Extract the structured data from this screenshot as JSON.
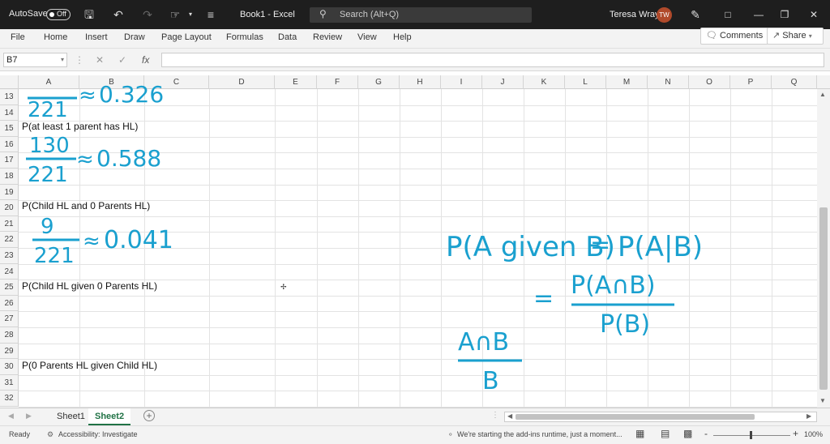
{
  "titlebar": {
    "autosave_label": "AutoSave",
    "autosave_state": "Off",
    "doc_title": "Book1 - Excel",
    "search_placeholder": "Search (Alt+Q)",
    "user_name": "Teresa Wray",
    "user_initials": "TW"
  },
  "menu": {
    "items": [
      "File",
      "Home",
      "Insert",
      "Draw",
      "Page Layout",
      "Formulas",
      "Data",
      "Review",
      "View",
      "Help"
    ],
    "comments_label": "Comments",
    "share_label": "Share"
  },
  "formula_bar": {
    "name_box": "B7",
    "fx_label": "fx",
    "formula": ""
  },
  "columns": [
    "A",
    "B",
    "C",
    "D",
    "E",
    "F",
    "G",
    "H",
    "I",
    "J",
    "K",
    "L",
    "M",
    "N",
    "O",
    "P",
    "Q"
  ],
  "rows": [
    "13",
    "14",
    "15",
    "16",
    "17",
    "18",
    "19",
    "20",
    "21",
    "22",
    "23",
    "24",
    "25",
    "26",
    "27",
    "28",
    "29",
    "30",
    "31",
    "32"
  ],
  "cells": {
    "a15": "P(at least 1 parent has HL)",
    "a20": "P(Child HL and 0 Parents HL)",
    "a25": "P(Child HL given 0 Parents HL)",
    "a30": "P(0 Parents HL given Child HL)"
  },
  "ink": {
    "frac1_den": "221",
    "frac1_val": "0.326",
    "frac2_num": "130",
    "frac2_den": "221",
    "frac2_val": "0.588",
    "frac3_num": "9",
    "frac3_den": "221",
    "frac3_val": "0.041",
    "approx": "≈",
    "eq1_left": "P(A given B)",
    "eq1_mid": "=",
    "eq1_right": "P(A|B)",
    "eq2_eq": "=",
    "eq2_num": "P(A∩B)",
    "eq2_den": "P(B)",
    "frac4_num": "A∩B",
    "frac4_den": "B"
  },
  "sheets": {
    "tabs": [
      "Sheet1",
      "Sheet2"
    ],
    "active": "Sheet2",
    "add_label": "+"
  },
  "status": {
    "ready": "Ready",
    "accessibility": "Accessibility: Investigate",
    "message": "We're starting the add-ins runtime, just a moment...",
    "zoom": "100%",
    "zoom_minus": "-",
    "zoom_plus": "+"
  },
  "colors": {
    "ink": "#1aa0cf",
    "excel_green": "#217346",
    "titlebar": "#1e1e1e"
  }
}
